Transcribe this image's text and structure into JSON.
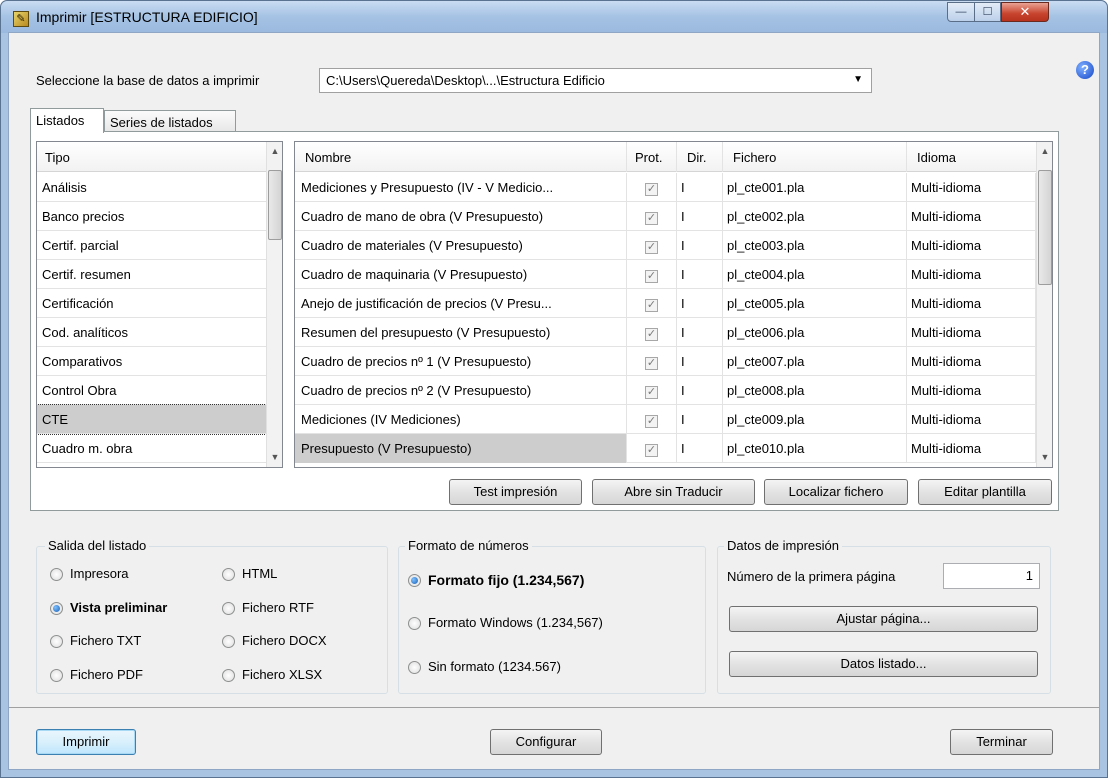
{
  "window": {
    "title": "Imprimir [ESTRUCTURA EDIFICIO]",
    "min_glyph": "—",
    "max_glyph": "☐",
    "close_glyph": "✕",
    "help_glyph": "?"
  },
  "db": {
    "label": "Seleccione la base de datos a imprimir",
    "value": "C:\\Users\\Quereda\\Desktop\\...\\Estructura Edificio"
  },
  "tabs": [
    {
      "label": "Listados"
    },
    {
      "label": "Series de listados"
    }
  ],
  "tipo": {
    "header": "Tipo",
    "items": [
      "Análisis",
      "Banco precios",
      "Certif. parcial",
      "Certif. resumen",
      "Certificación",
      "Cod. analíticos",
      "Comparativos",
      "Control Obra",
      "CTE",
      "Cuadro m. obra"
    ],
    "selected_index": 8
  },
  "listados": {
    "headers": {
      "nombre": "Nombre",
      "prot": "Prot.",
      "dir": "Dir.",
      "fichero": "Fichero",
      "idioma": "Idioma"
    },
    "rows": [
      {
        "nombre": "Mediciones y Presupuesto (IV - V Medicio...",
        "prot": true,
        "dir": "I",
        "fichero": "pl_cte001.pla",
        "idioma": "Multi-idioma"
      },
      {
        "nombre": "Cuadro de mano de obra (V  Presupuesto)",
        "prot": true,
        "dir": "I",
        "fichero": "pl_cte002.pla",
        "idioma": "Multi-idioma"
      },
      {
        "nombre": "Cuadro de materiales (V  Presupuesto)",
        "prot": true,
        "dir": "I",
        "fichero": "pl_cte003.pla",
        "idioma": "Multi-idioma"
      },
      {
        "nombre": "Cuadro de maquinaria (V  Presupuesto)",
        "prot": true,
        "dir": "I",
        "fichero": "pl_cte004.pla",
        "idioma": "Multi-idioma"
      },
      {
        "nombre": "Anejo de justificación de precios (V  Presu...",
        "prot": true,
        "dir": "I",
        "fichero": "pl_cte005.pla",
        "idioma": "Multi-idioma"
      },
      {
        "nombre": "Resumen del presupuesto (V  Presupuesto)",
        "prot": true,
        "dir": "I",
        "fichero": "pl_cte006.pla",
        "idioma": "Multi-idioma"
      },
      {
        "nombre": "Cuadro de precios nº 1 (V  Presupuesto)",
        "prot": true,
        "dir": "I",
        "fichero": "pl_cte007.pla",
        "idioma": "Multi-idioma"
      },
      {
        "nombre": "Cuadro de precios nº 2 (V Presupuesto)",
        "prot": true,
        "dir": "I",
        "fichero": "pl_cte008.pla",
        "idioma": "Multi-idioma"
      },
      {
        "nombre": "Mediciones (IV Mediciones)",
        "prot": true,
        "dir": "I",
        "fichero": "pl_cte009.pla",
        "idioma": "Multi-idioma"
      },
      {
        "nombre": "Presupuesto (V Presupuesto)",
        "prot": true,
        "dir": "I",
        "fichero": "pl_cte010.pla",
        "idioma": "Multi-idioma"
      }
    ],
    "selected_index": 9
  },
  "actions": {
    "test": "Test impresión",
    "abre": "Abre sin Traducir",
    "localizar": "Localizar fichero",
    "editar": "Editar plantilla"
  },
  "salida": {
    "title": "Salida del listado",
    "options": [
      "Impresora",
      "Vista preliminar",
      "Fichero TXT",
      "Fichero PDF",
      "HTML",
      "Fichero RTF",
      "Fichero DOCX",
      "Fichero XLSX"
    ],
    "selected": "Vista preliminar"
  },
  "formato": {
    "title": "Formato de números",
    "options": [
      "Formato fijo (1.234,567)",
      "Formato Windows (1.234,567)",
      "Sin formato (1234.567)"
    ],
    "selected": "Formato fijo (1.234,567)"
  },
  "datos": {
    "title": "Datos de impresión",
    "first_page_label": "Número de la primera página",
    "first_page_value": "1",
    "ajustar": "Ajustar página...",
    "datos_listado": "Datos listado..."
  },
  "footer": {
    "imprimir": "Imprimir",
    "configurar": "Configurar",
    "terminar": "Terminar"
  }
}
